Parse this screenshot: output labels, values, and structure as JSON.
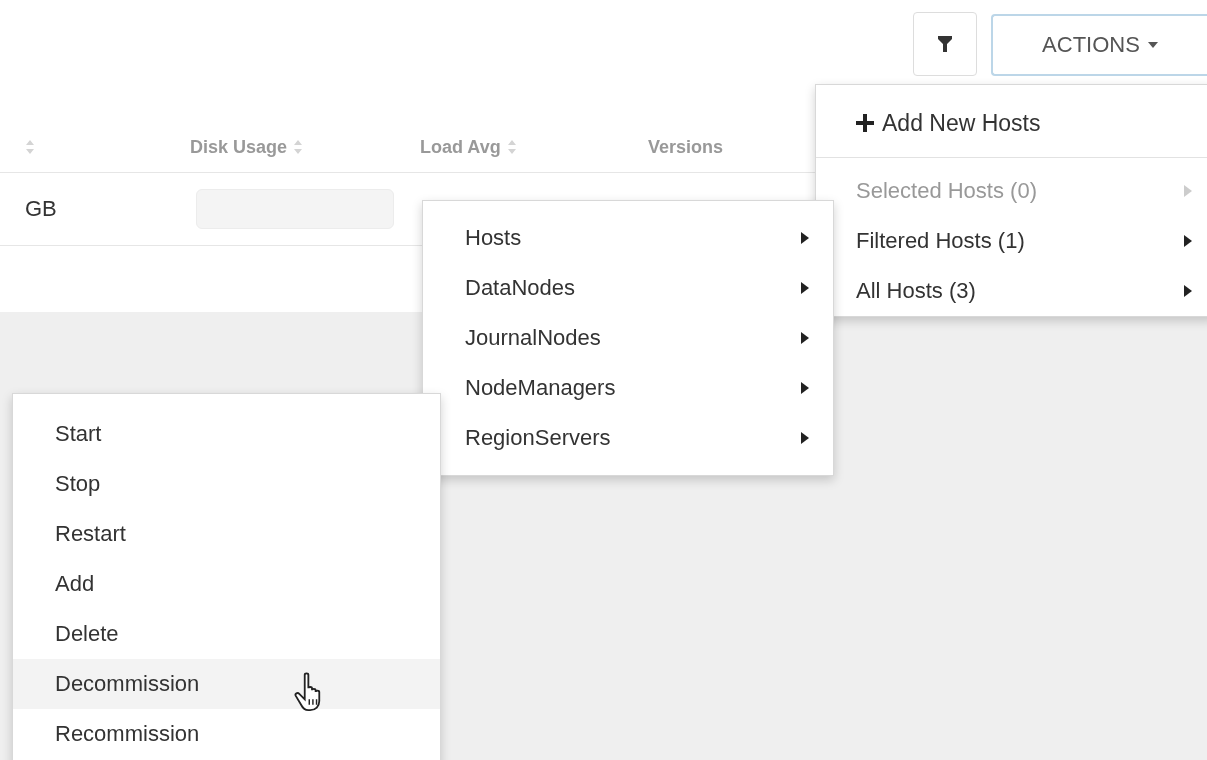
{
  "toolbar": {
    "actions_button": {
      "label": "ACTIONS"
    }
  },
  "table": {
    "columns": [
      "",
      "Disk Usage",
      "Load Avg",
      "Versions"
    ],
    "rows": [
      {
        "cells": [
          "GB",
          "",
          ""
        ]
      }
    ]
  },
  "actions_menu": {
    "header_item": {
      "label": "Add New Hosts"
    },
    "items": [
      {
        "label": "Selected Hosts (0)",
        "disabled": true
      },
      {
        "label": "Filtered Hosts (1)",
        "disabled": false
      },
      {
        "label": "All Hosts (3)",
        "disabled": false
      }
    ]
  },
  "component_menu": {
    "items": [
      {
        "label": "Hosts"
      },
      {
        "label": "DataNodes"
      },
      {
        "label": "JournalNodes"
      },
      {
        "label": "NodeManagers"
      },
      {
        "label": "RegionServers"
      }
    ]
  },
  "service_action_menu": {
    "items": [
      {
        "label": "Start",
        "selected": false
      },
      {
        "label": "Stop",
        "selected": false
      },
      {
        "label": "Restart",
        "selected": false
      },
      {
        "label": "Add",
        "selected": false
      },
      {
        "label": "Delete",
        "selected": false
      },
      {
        "label": "Decommission",
        "selected": true
      },
      {
        "label": "Recommission",
        "selected": false
      }
    ]
  }
}
